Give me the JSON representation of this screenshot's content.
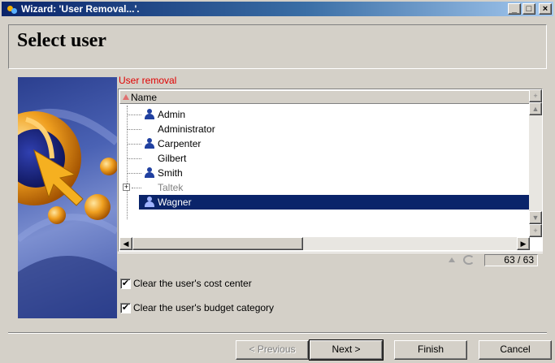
{
  "window": {
    "title": "Wizard: 'User Removal...'."
  },
  "titlebar_buttons": {
    "minimize": "_",
    "maximize": "□",
    "close": "×"
  },
  "header": {
    "title": "Select user"
  },
  "section": {
    "label": "User removal"
  },
  "list": {
    "column_header": "Name",
    "rows": [
      {
        "label": "Admin",
        "icon": "user-icon"
      },
      {
        "label": "Administrator",
        "icon": ""
      },
      {
        "label": "Carpenter",
        "icon": "user-icon"
      },
      {
        "label": "Gilbert",
        "icon": ""
      },
      {
        "label": "Smith",
        "icon": "user-icon"
      },
      {
        "label": "Taltek",
        "icon": "",
        "expandable": true,
        "dimmed": true
      },
      {
        "label": "Wagner",
        "icon": "user-icon",
        "selected": true
      }
    ],
    "count": "63 / 63"
  },
  "options": {
    "clear_cost_center": {
      "label": "Clear the user's cost center",
      "checked": true
    },
    "clear_budget_category": {
      "label": "Clear the user's budget category",
      "checked": true
    }
  },
  "buttons": {
    "previous": "< Previous",
    "next": "Next >",
    "finish": "Finish",
    "cancel": "Cancel"
  },
  "colors": {
    "selection": "#0a246a",
    "section_label": "#e00000",
    "titlebar": "#0a246a"
  }
}
